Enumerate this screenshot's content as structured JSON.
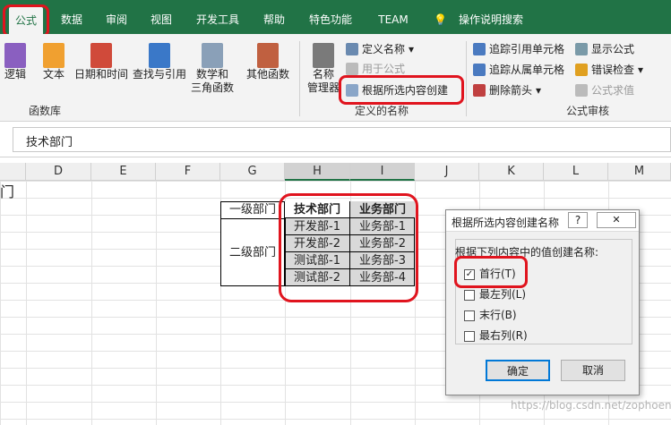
{
  "tabs": [
    "公式",
    "数据",
    "审阅",
    "视图",
    "开发工具",
    "帮助",
    "特色功能",
    "TEAM",
    "操作说明搜索"
  ],
  "ribbon": {
    "btns": {
      "logic": "逻辑",
      "text": "文本",
      "datetime": "日期和时间",
      "lookup": "查找与引用",
      "math1": "数学和",
      "math2": "三角函数",
      "more": "其他函数",
      "namemgr1": "名称",
      "namemgr2": "管理器"
    },
    "define_name": "定义名称",
    "use_in_formula": "用于公式",
    "create_from_sel": "根据所选内容创建",
    "trace_prec": "追踪引用单元格",
    "trace_dep": "追踪从属单元格",
    "remove_arrows": "删除箭头",
    "show_formulas": "显示公式",
    "error_check": "错误检查",
    "eval_formula": "公式求值",
    "group_lib": "函数库",
    "group_names": "定义的名称",
    "group_audit": "公式审核"
  },
  "formula_bar": {
    "value": "技术部门"
  },
  "columns": [
    "D",
    "E",
    "F",
    "G",
    "H",
    "I",
    "J",
    "K",
    "L",
    "M"
  ],
  "sheet": {
    "a_col": "门",
    "l1": "一级部门",
    "l2": "二级部门",
    "h_head": "技术部门",
    "i_head": "业务部门",
    "h": [
      "开发部-1",
      "开发部-2",
      "测试部-1",
      "测试部-2"
    ],
    "i": [
      "业务部-1",
      "业务部-2",
      "业务部-3",
      "业务部-4"
    ]
  },
  "dialog": {
    "title": "根据所选内容创建名称",
    "help": "?",
    "close": "✕",
    "prompt": "根据下列内容中的值创建名称:",
    "opts": [
      "首行(T)",
      "最左列(L)",
      "末行(B)",
      "最右列(R)"
    ],
    "ok": "确定",
    "cancel": "取消"
  },
  "watermark": "https://blog.csdn.net/zophoenix",
  "colors": {
    "brand": "#217346",
    "highlight": "#e0141e"
  }
}
